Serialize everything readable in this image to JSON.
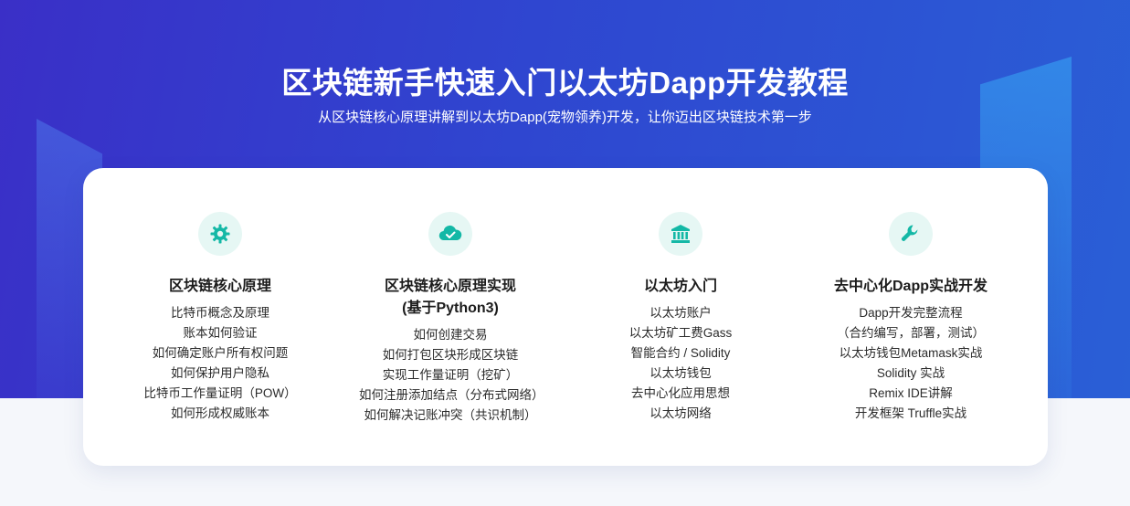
{
  "header": {
    "title": "区块链新手快速入门以太坊Dapp开发教程",
    "subtitle": "从区块链核心原理讲解到以太坊Dapp(宠物领养)开发，让你迈出区块链技术第一步"
  },
  "colors": {
    "accent": "#14b8a6",
    "icon_bg": "#e6f7f4",
    "hero_start": "#3a2fc7",
    "hero_end": "#2a5fd6"
  },
  "columns": [
    {
      "icon": "gear-icon",
      "title": "区块链核心原理",
      "title2": "",
      "items": [
        "比特币概念及原理",
        "账本如何验证",
        "如何确定账户所有权问题",
        "如何保护用户隐私",
        "比特币工作量证明（POW）",
        "如何形成权威账本"
      ]
    },
    {
      "icon": "cloud-check-icon",
      "title": "区块链核心原理实现",
      "title2": "(基于Python3)",
      "items": [
        "如何创建交易",
        "如何打包区块形成区块链",
        "实现工作量证明（挖矿）",
        "如何注册添加结点（分布式网络）",
        "如何解决记账冲突（共识机制）"
      ]
    },
    {
      "icon": "bank-icon",
      "title": "以太坊入门",
      "title2": "",
      "items": [
        "以太坊账户",
        "以太坊矿工费Gass",
        "智能合约 / Solidity",
        "以太坊钱包",
        "去中心化应用思想",
        "以太坊网络"
      ]
    },
    {
      "icon": "wrench-icon",
      "title": "去中心化Dapp实战开发",
      "title2": "",
      "items": [
        "Dapp开发完整流程",
        "（合约编写，部署，测试）",
        "以太坊钱包Metamask实战",
        "Solidity 实战",
        "Remix IDE讲解",
        "开发框架 Truffle实战"
      ]
    }
  ]
}
